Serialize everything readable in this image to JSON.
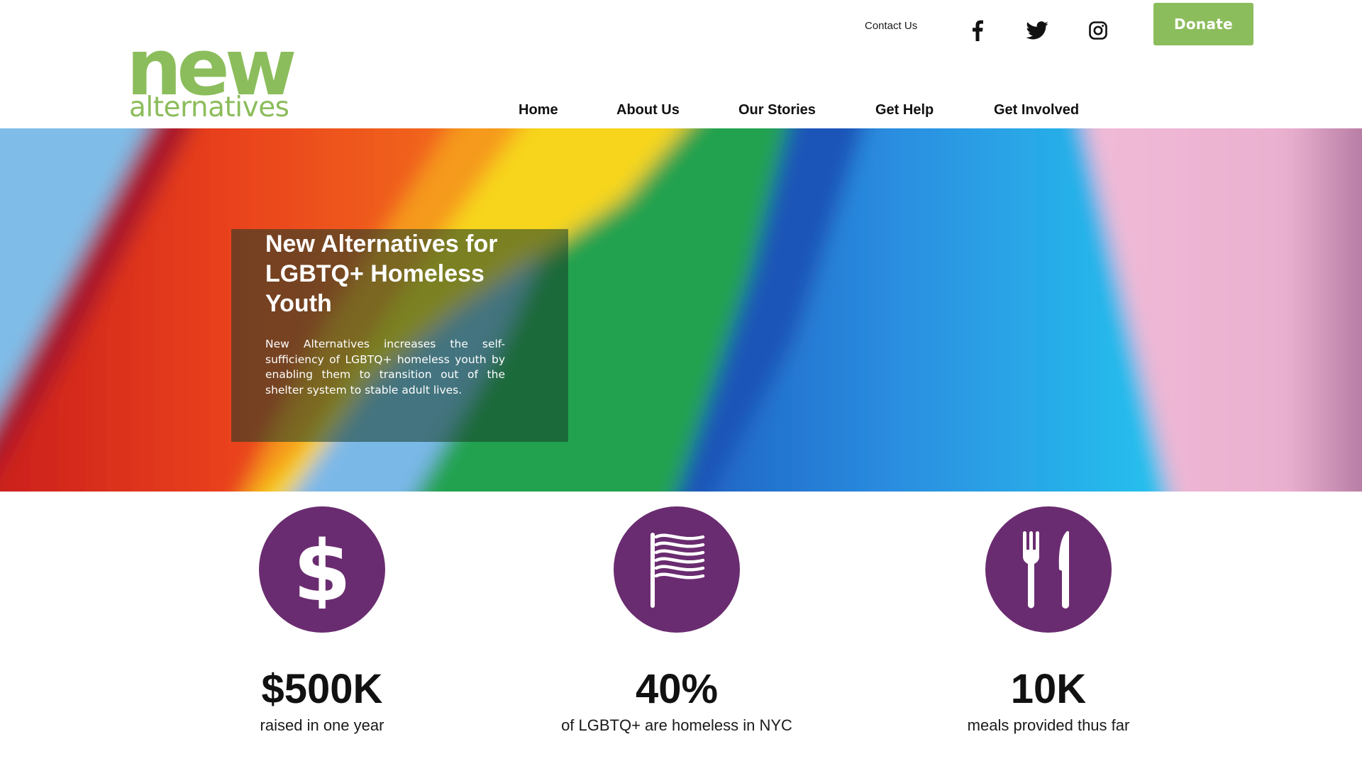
{
  "header": {
    "logo": {
      "primary": "new",
      "secondary": "alternatives",
      "color": "#8cbd5c"
    },
    "contact_label": "Contact Us",
    "social_icons": [
      "facebook-icon",
      "twitter-icon",
      "instagram-icon"
    ],
    "donate_label": "Donate",
    "nav": {
      "home": "Home",
      "about": "About Us",
      "stories": "Our Stories",
      "help": "Get Help",
      "involved": "Get Involved"
    }
  },
  "hero": {
    "title": "New Alternatives for LGBTQ+ Homeless Youth",
    "description": "New Alternatives increases the self-sufficiency of LGBTQ+ homeless youth by enabling them to transition out of the shelter system to stable adult lives.",
    "background": "rainbow pride flag"
  },
  "stats": [
    {
      "icon": "dollar-icon",
      "value": "$500K",
      "label": "raised in one year"
    },
    {
      "icon": "flag-icon",
      "value": "40%",
      "label": "of LGBTQ+ are homeless in NYC"
    },
    {
      "icon": "fork-knife-icon",
      "value": "10K",
      "label": "meals provided thus far"
    }
  ],
  "colors": {
    "brand_green": "#8cbd5c",
    "stat_purple": "#6a2c70",
    "hero_overlay": "#163c28"
  }
}
